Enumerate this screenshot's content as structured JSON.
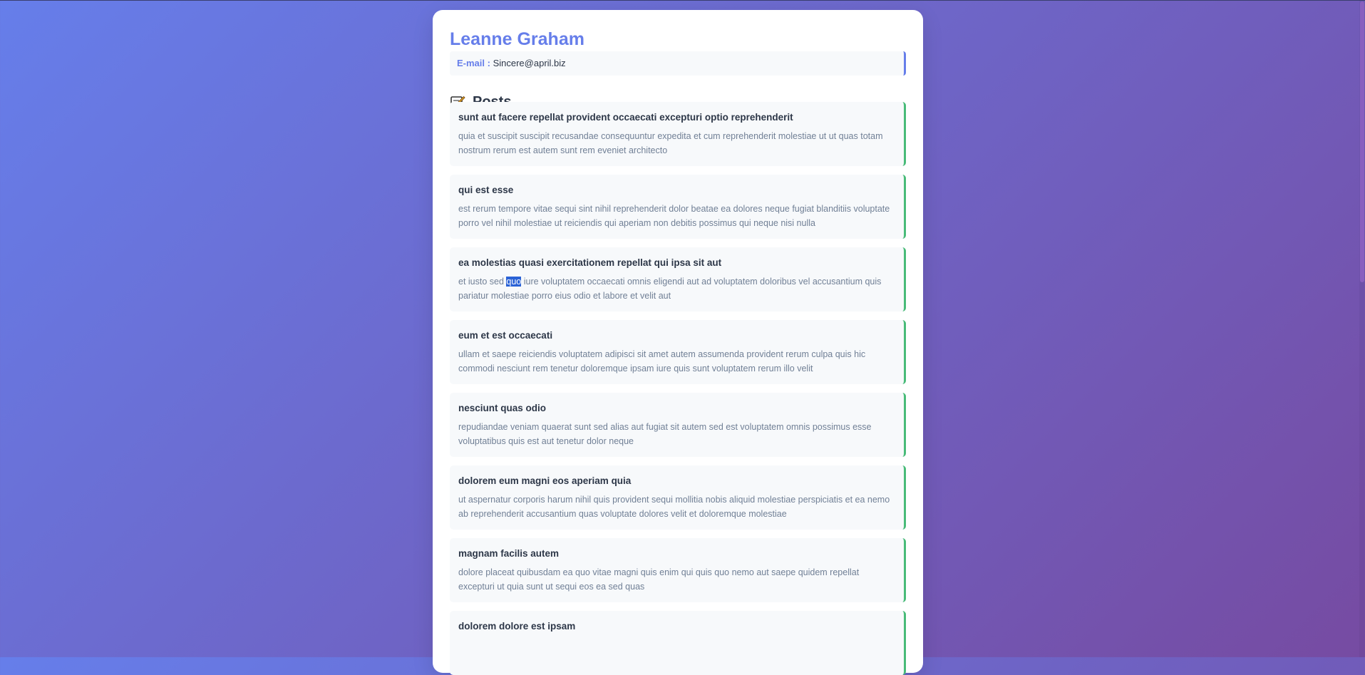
{
  "user": {
    "name": "Leanne Graham",
    "email_label": "E-mail",
    "email_value": "Sincere@april.biz"
  },
  "posts_section": {
    "icon": "memo-icon",
    "title": "Posts"
  },
  "posts": [
    {
      "title": "sunt aut facere repellat provident occaecati excepturi optio reprehenderit",
      "body": "quia et suscipit suscipit recusandae consequuntur expedita et cum reprehenderit molestiae ut ut quas totam nostrum rerum est autem sunt rem eveniet architecto"
    },
    {
      "title": "qui est esse",
      "body": "est rerum tempore vitae sequi sint nihil reprehenderit dolor beatae ea dolores neque fugiat blanditiis voluptate porro vel nihil molestiae ut reiciendis qui aperiam non debitis possimus qui neque nisi nulla"
    },
    {
      "title": "ea molestias quasi exercitationem repellat qui ipsa sit aut",
      "body_before": "et iusto sed ",
      "body_selected": "quo",
      "body_after": " iure voluptatem occaecati omnis eligendi aut ad voluptatem doloribus vel accusantium quis pariatur molestiae porro eius odio et labore et velit aut"
    },
    {
      "title": "eum et est occaecati",
      "body": "ullam et saepe reiciendis voluptatem adipisci sit amet autem assumenda provident rerum culpa quis hic commodi nesciunt rem tenetur doloremque ipsam iure quis sunt voluptatem rerum illo velit"
    },
    {
      "title": "nesciunt quas odio",
      "body": "repudiandae veniam quaerat sunt sed alias aut fugiat sit autem sed est voluptatem omnis possimus esse voluptatibus quis est aut tenetur dolor neque"
    },
    {
      "title": "dolorem eum magni eos aperiam quia",
      "body": "ut aspernatur corporis harum nihil quis provident sequi mollitia nobis aliquid molestiae perspiciatis et ea nemo ab reprehenderit accusantium quas voluptate dolores velit et doloremque molestiae"
    },
    {
      "title": "magnam facilis autem",
      "body": "dolore placeat quibusdam ea quo vitae magni quis enim qui quis quo nemo aut saepe quidem repellat excepturi ut quia sunt ut sequi eos ea sed quas"
    },
    {
      "title": "dolorem dolore est ipsam",
      "body": ""
    }
  ],
  "colors": {
    "accent": "#667eea",
    "post_border": "#48bb78",
    "background_start": "#667eea",
    "background_end": "#764ba2",
    "selection": "#2a62d6"
  }
}
